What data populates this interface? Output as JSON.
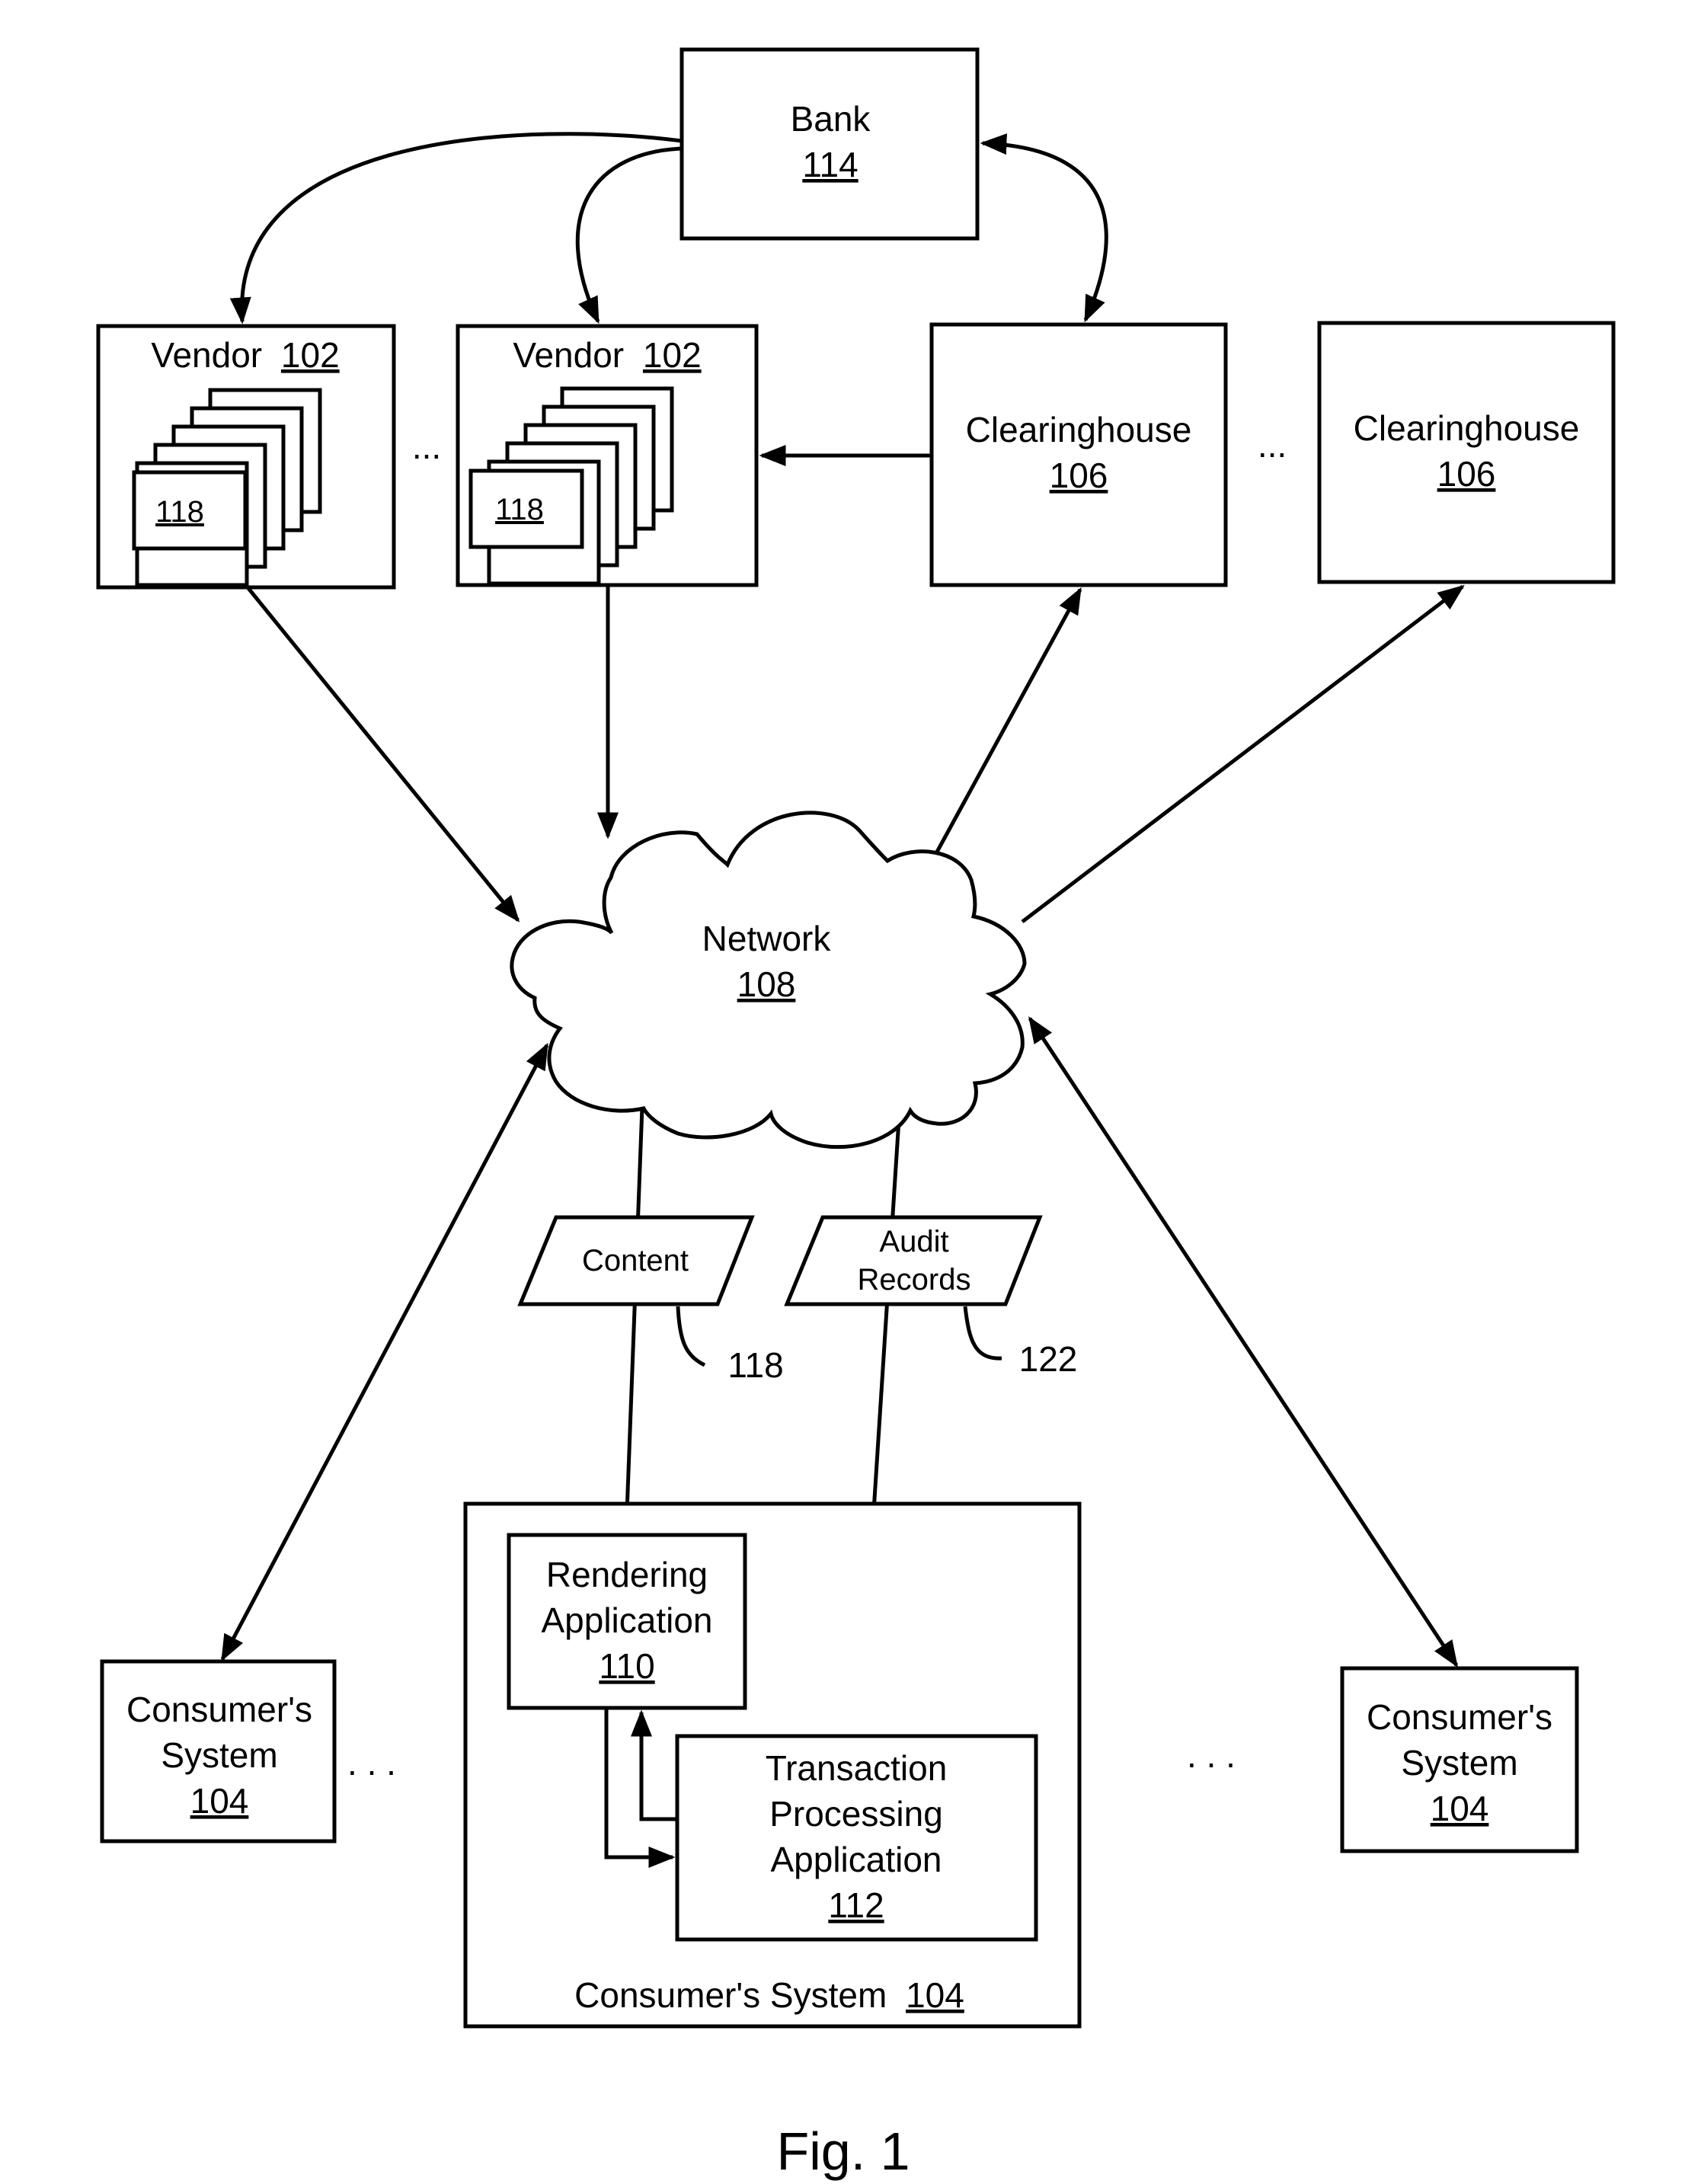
{
  "figure": {
    "caption": "Fig. 1"
  },
  "nodes": {
    "bank": {
      "name": "Bank",
      "ref": "114"
    },
    "vendor_1": {
      "name": "Vendor",
      "ref": "102",
      "content_ref": "118"
    },
    "vendor_2": {
      "name": "Vendor",
      "ref": "102",
      "content_ref": "118"
    },
    "clearinghouse_1": {
      "name": "Clearinghouse",
      "ref": "106"
    },
    "clearinghouse_2": {
      "name": "Clearinghouse",
      "ref": "106"
    },
    "network": {
      "name": "Network",
      "ref": "108"
    },
    "content": {
      "name": "Content",
      "callout": "118"
    },
    "audit_records": {
      "line1": "Audit",
      "line2": "Records",
      "callout": "122"
    },
    "consumer_left": {
      "line1": "Consumer's",
      "line2": "System",
      "ref": "104"
    },
    "consumer_right": {
      "line1": "Consumer's",
      "line2": "System",
      "ref": "104"
    },
    "consumer_main": {
      "name": "Consumer's System",
      "ref": "104"
    },
    "rendering_app": {
      "line1": "Rendering",
      "line2": "Application",
      "ref": "110"
    },
    "transaction_app": {
      "line1": "Transaction",
      "line2": "Processing",
      "line3": "Application",
      "ref": "112"
    }
  },
  "ellipses": {
    "vendors": "...",
    "clearinghouses": "...",
    "consumers_left": ". . .",
    "consumers_right": ". . ."
  }
}
